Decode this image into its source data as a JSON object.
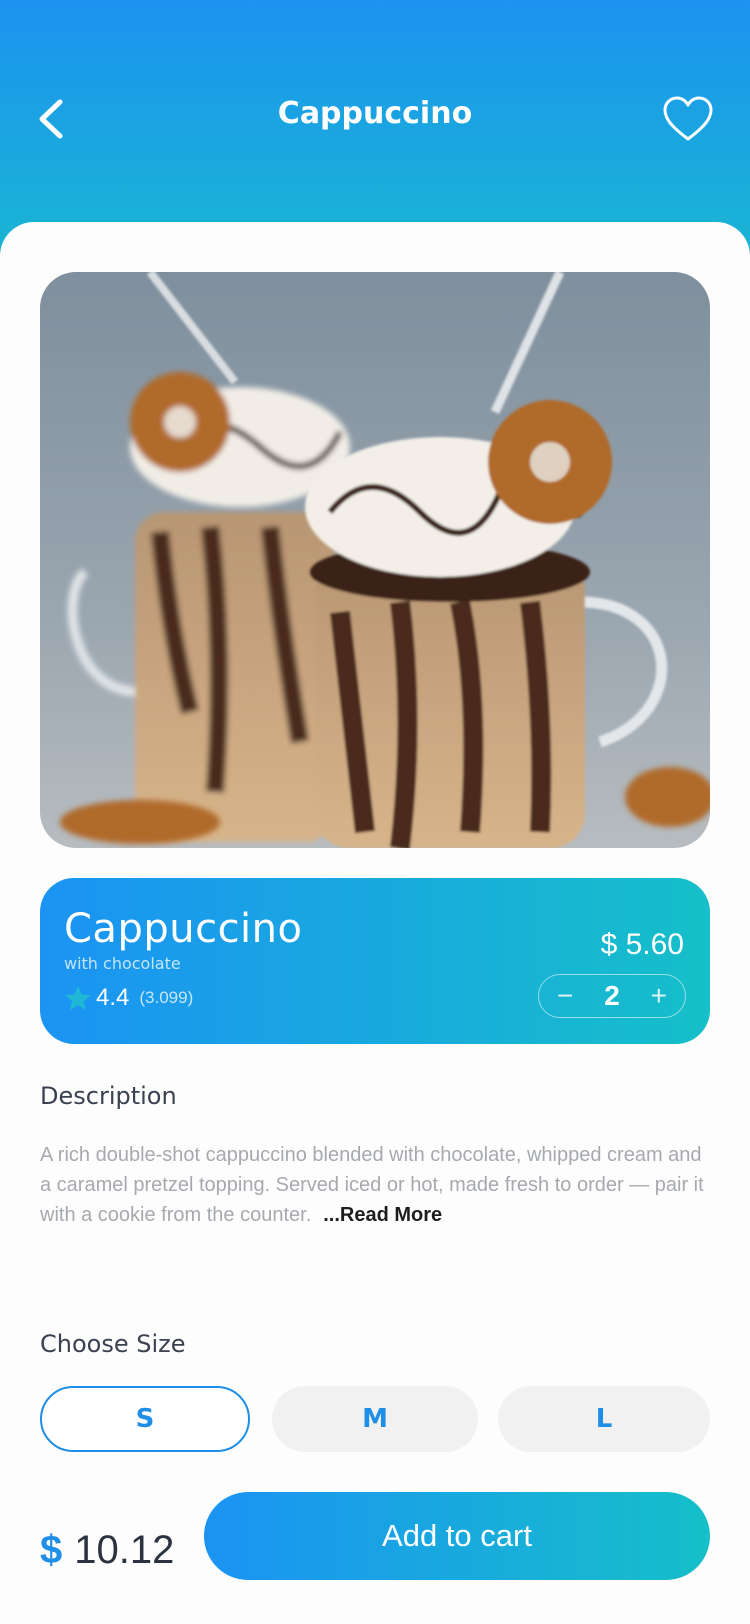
{
  "header": {
    "title": "Cappuccino",
    "back_icon": "chevron-left-icon",
    "favorite_icon": "heart-outline-icon"
  },
  "product": {
    "name": "Cappuccino",
    "subtitle": "with chocolate",
    "rating": "4.4",
    "rating_count": "(3.099)",
    "price": "$ 5.60",
    "quantity": "2",
    "minus_label": "−",
    "plus_label": "+"
  },
  "description": {
    "title": "Description",
    "text": "A rich double-shot cappuccino blended with chocolate, whipped cream and a caramel pretzel topping. Served iced or hot, made fresh to order — pair it with a cookie from the counter.",
    "read_more": "...Read More"
  },
  "size": {
    "title": "Choose Size",
    "options": [
      "S",
      "M",
      "L"
    ],
    "selected": "S"
  },
  "footer": {
    "currency": "$",
    "total": "10.12",
    "add_to_cart": "Add to cart"
  },
  "colors": {
    "accent": "#1f8ee6",
    "gradient_start": "#1b93f3",
    "gradient_end": "#16bfc9"
  }
}
